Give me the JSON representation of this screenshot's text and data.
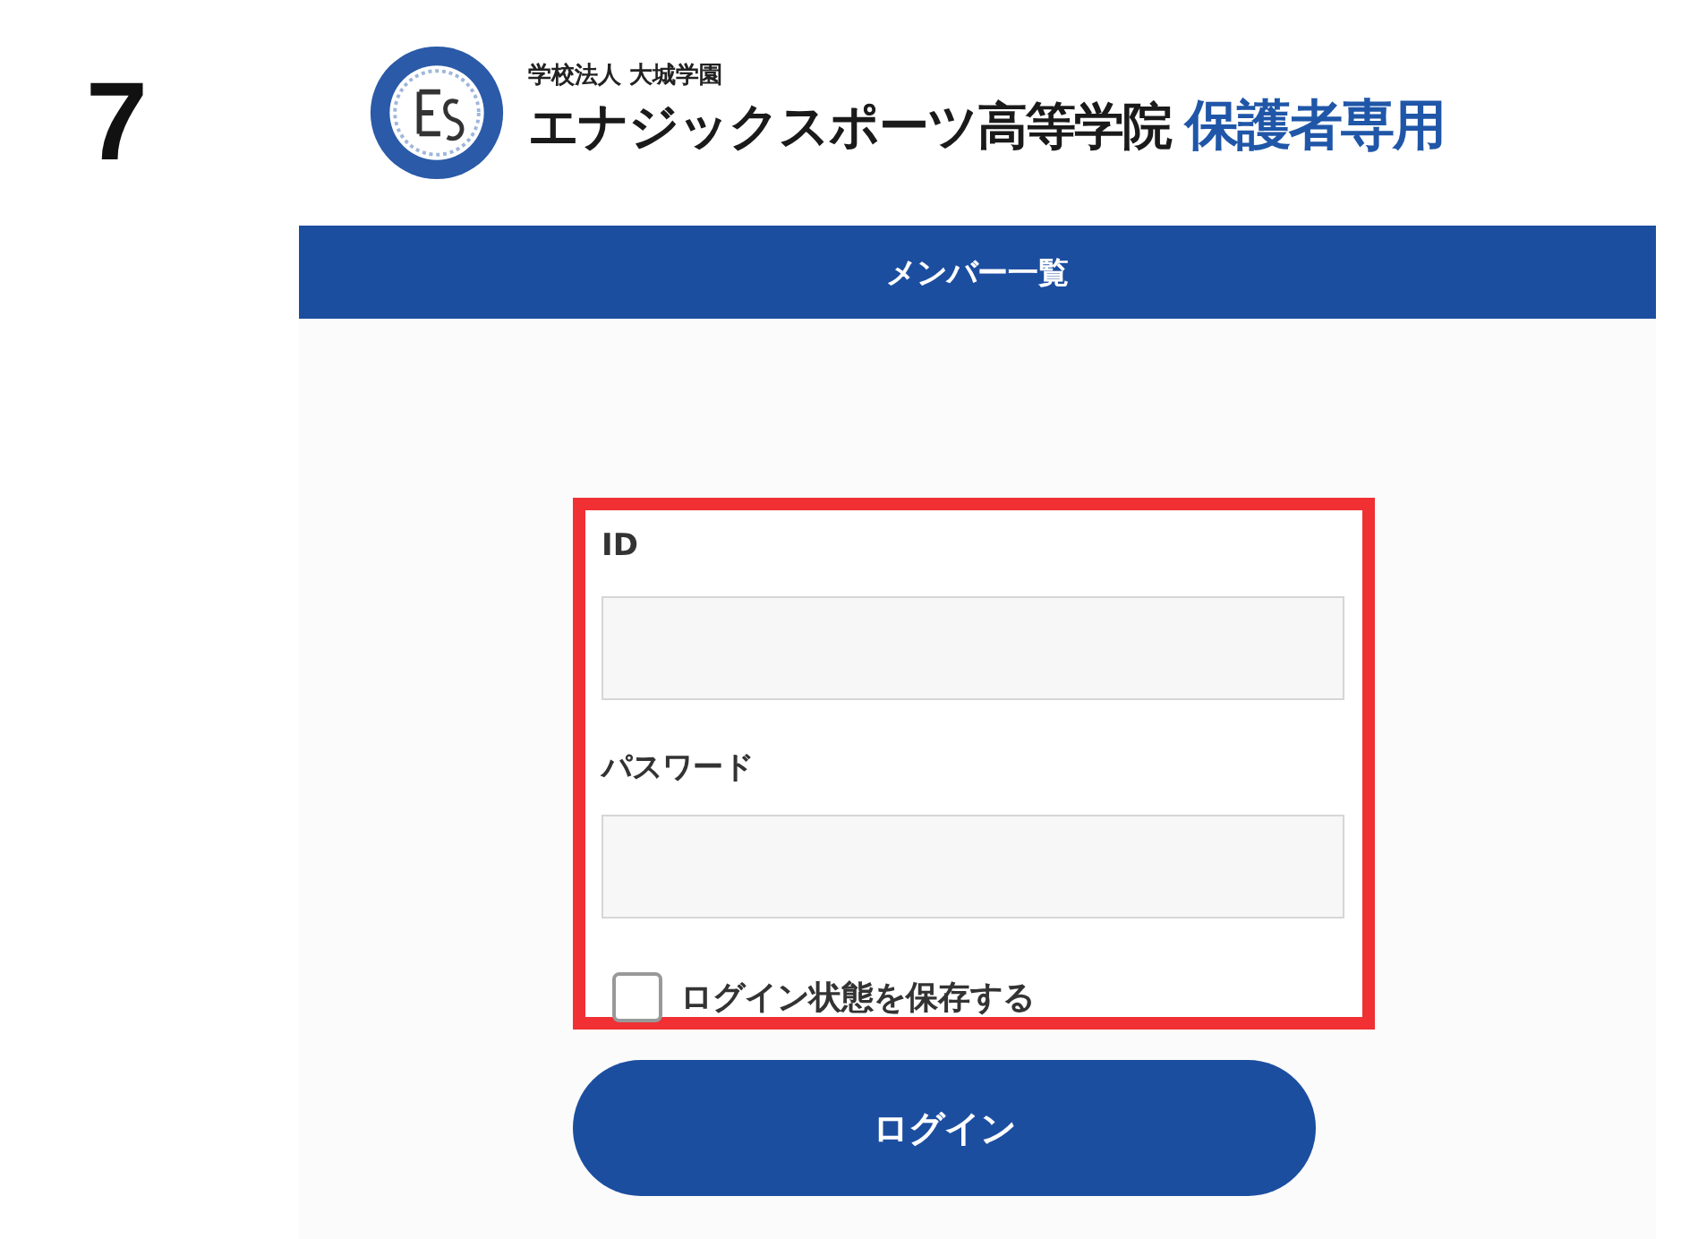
{
  "step_number": "7",
  "header": {
    "org": "学校法人 大城学園",
    "school": "エナジックスポーツ高等学院",
    "subtitle": "保護者専用"
  },
  "nav_bar": {
    "title": "メンバー一覧"
  },
  "login_form": {
    "fields": [
      {
        "label": "ID"
      },
      {
        "label": "パスワード"
      }
    ],
    "remember": {
      "label": "ログイン状態を保存する",
      "checked": false
    },
    "submit": "ログイン"
  }
}
